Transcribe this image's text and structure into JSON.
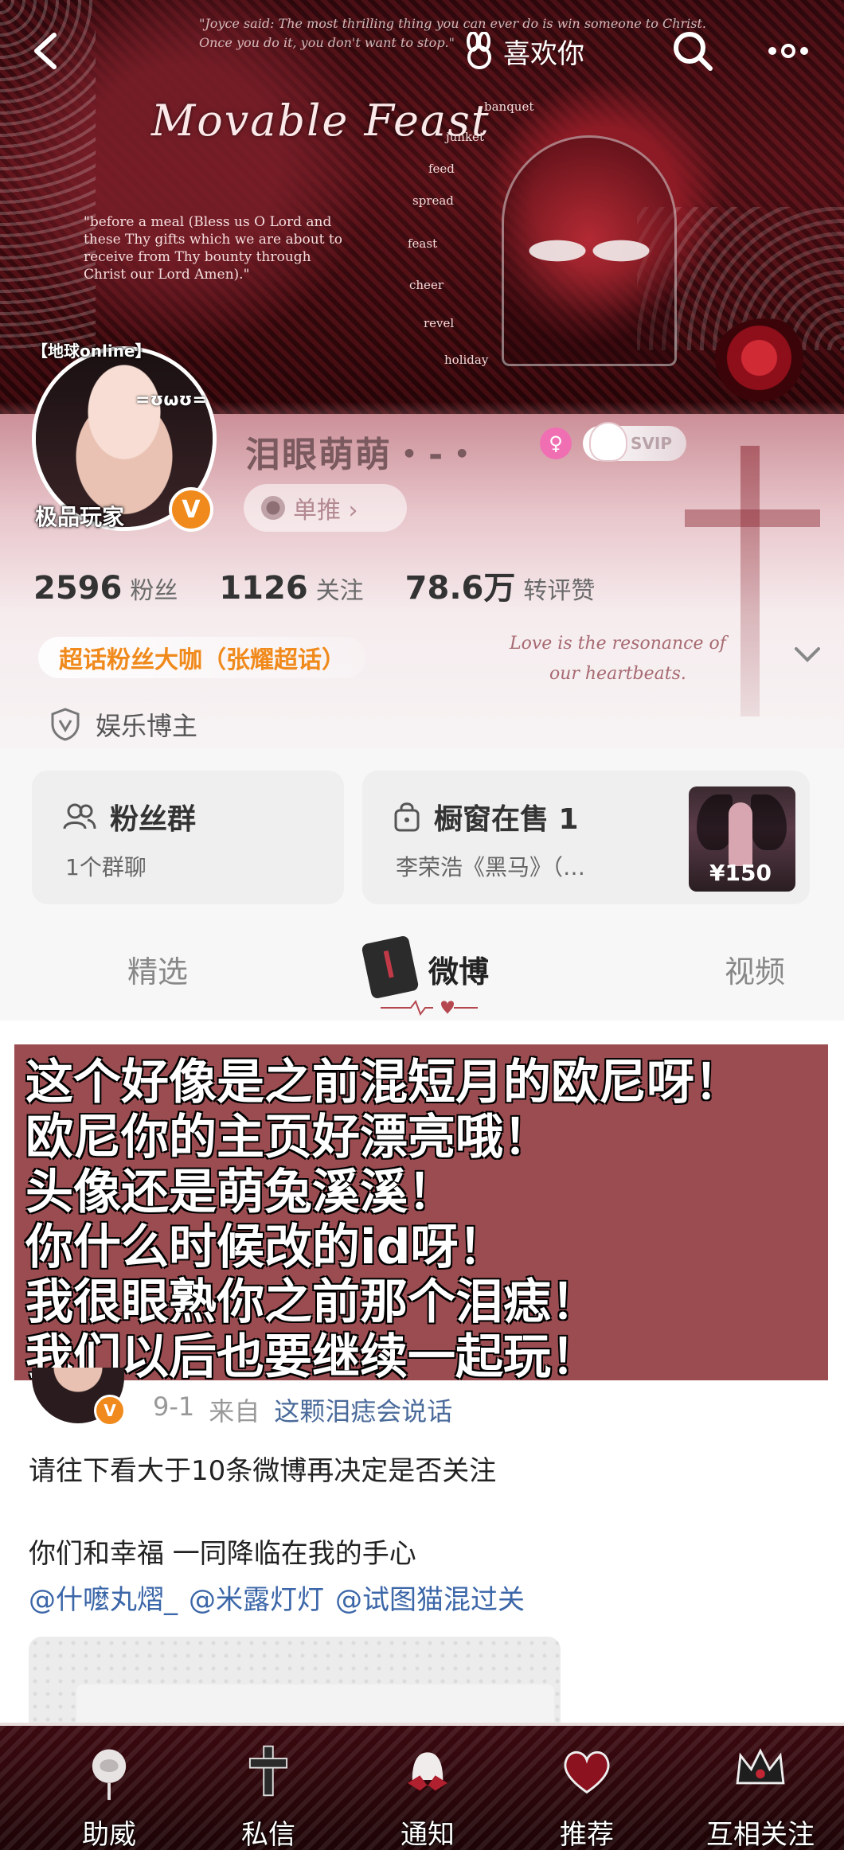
{
  "banner": {
    "quote_line1": "\"Joyce said: The most thrilling thing you can ever do is win someone to Christ.",
    "quote_line2": "Once you do it, you don't want to stop.\"",
    "title": "Movable Feast",
    "prayer_line1": "\"before a meal (Bless us O Lord and these Thy gifts which we are about to receive",
    "prayer_line2": "from Thy bounty through Christ our Lord Amen).\"",
    "prayer_block": "\"before a meal (Bless us O Lord and these Thy gifts which we are about to receive from Thy bounty through Christ our Lord Amen).\"",
    "words": [
      "banquet",
      "junket",
      "feed",
      "spread",
      "feast",
      "cheer",
      "revel",
      "holiday"
    ]
  },
  "topbar": {
    "like_label": "喜欢你"
  },
  "profile": {
    "earth_tag": "【地球online】",
    "face_tag": "=ʊωʊ=",
    "jipin_tag": "极品玩家",
    "v_badge": "V",
    "username": "泪眼萌萌・-・",
    "gender_symbol": "♀",
    "svip_label": "SVIP",
    "push_label": "单推 ›",
    "stats": [
      {
        "value": "2596",
        "label": "粉丝"
      },
      {
        "value": "1126",
        "label": "关注"
      },
      {
        "value": "78.6万",
        "label": "转评赞"
      }
    ],
    "chaohua_tag": "超话粉丝大咖（张耀超话）",
    "love_quote_1": "Love is the resonance of",
    "love_quote_2": "our heartbeats.",
    "verify": "娱乐博主"
  },
  "cards": {
    "fans_title": "粉丝群",
    "fans_sub": "1个群聊",
    "shop_title": "橱窗在售 1",
    "shop_sub": "李荣浩《黑马》（…",
    "shop_price": "¥150"
  },
  "tabs": {
    "featured": "精选",
    "weibo": "微博",
    "video": "视频"
  },
  "overlay": {
    "lines": [
      "这个好像是之前混短月的欧尼呀！",
      "欧尼你的主页好漂亮哦！",
      "头像还是萌兔溪溪！",
      "你什么时候改的id呀！",
      "我很眼熟你之前那个泪痣！",
      "我们以后也要继续一起玩！"
    ]
  },
  "post": {
    "v_badge": "V",
    "date": "9-1",
    "from_label": "来自",
    "source": "这颗泪痣会说话",
    "line1": "请往下看大于10条微博再决定是否关注",
    "line2": "你们和幸福 一同降临在我的手心",
    "mentions": [
      "@什嚒丸熠_",
      "@米露灯灯",
      "@试图猫混过关"
    ]
  },
  "bottom_nav": {
    "items": [
      "助威",
      "私信",
      "通知",
      "推荐",
      "互相关注"
    ]
  },
  "colors": {
    "accent_orange": "#f08a1c",
    "link_blue": "#3b66a8",
    "banner_red": "#5a1219",
    "overlay_bg": "#9b4c51"
  }
}
